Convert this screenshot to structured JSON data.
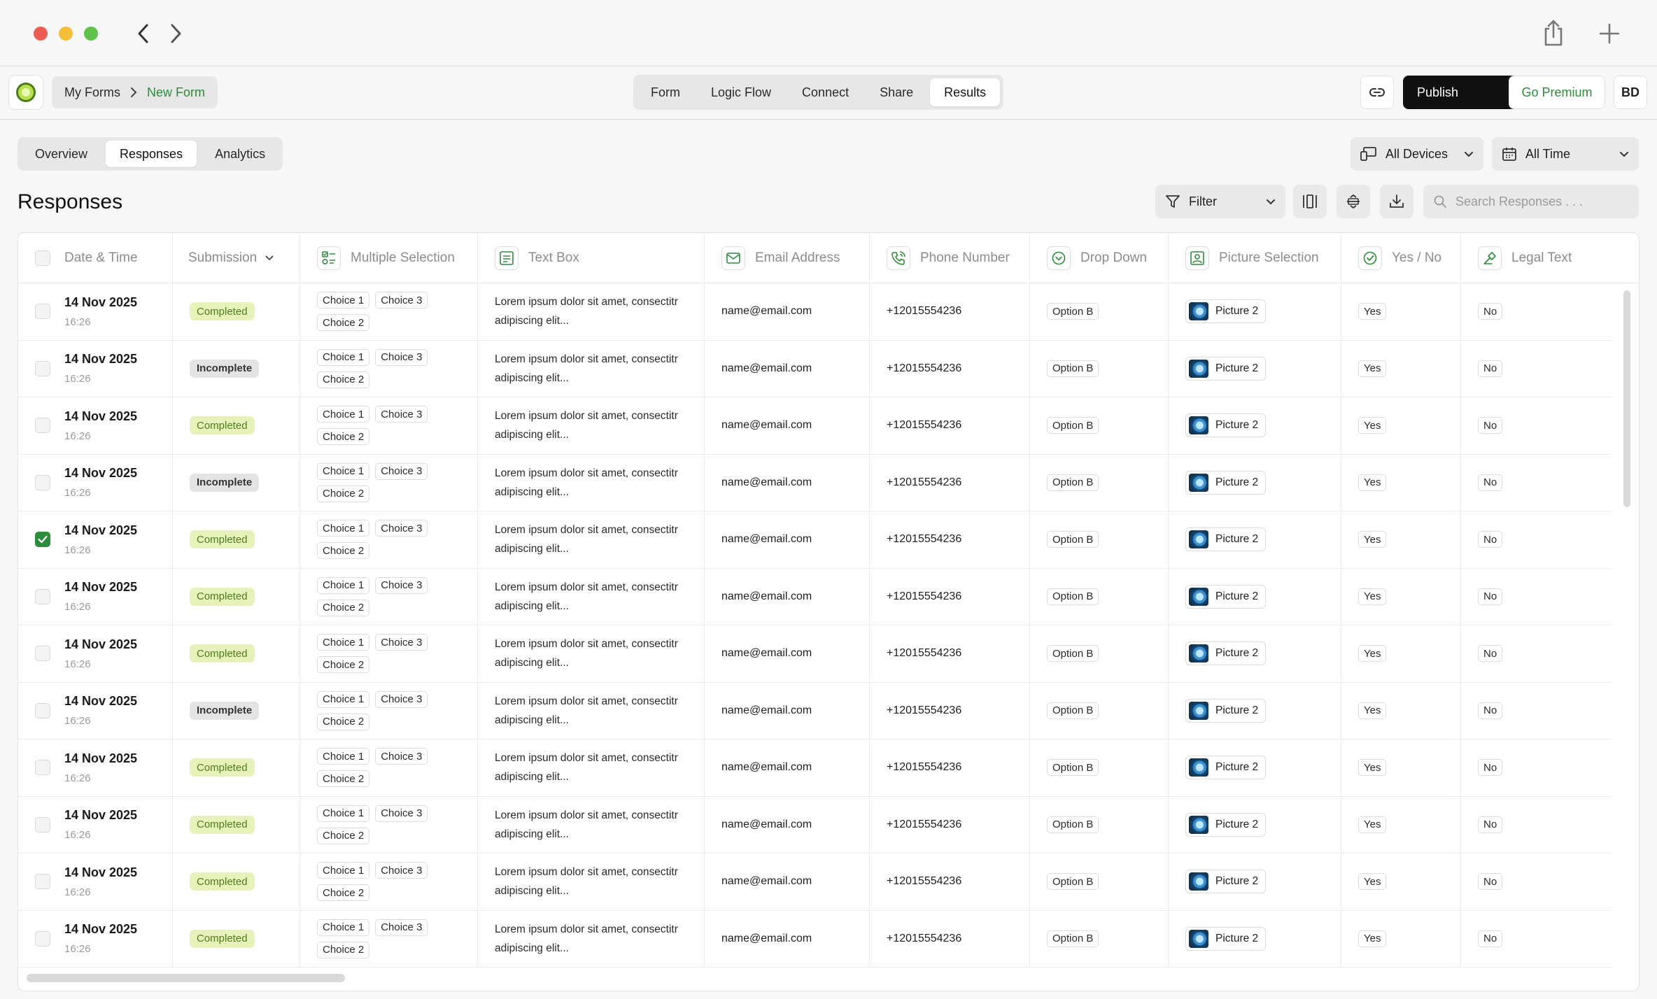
{
  "header": {
    "breadcrumb_home": "My Forms",
    "breadcrumb_current": "New Form",
    "nav_tabs": [
      "Form",
      "Logic Flow",
      "Connect",
      "Share",
      "Results"
    ],
    "active_nav_tab": "Results",
    "publish_label": "Publish",
    "premium_label": "Go Premium",
    "user_initials": "BD"
  },
  "subtabs": [
    "Overview",
    "Responses",
    "Analytics"
  ],
  "active_subtab": "Responses",
  "filters": {
    "devices_label": "All Devices",
    "time_label": "All Time",
    "filter_label": "Filter",
    "search_placeholder": "Search Responses . . ."
  },
  "page_title": "Responses",
  "columns": [
    "Date & Time",
    "Submission",
    "Multiple Selection",
    "Text Box",
    "Email Address",
    "Phone Number",
    "Drop Down",
    "Picture Selection",
    "Yes / No",
    "Legal Text"
  ],
  "column_icons": [
    "",
    "chevron-down-icon",
    "multiple-selection-icon",
    "text-box-icon",
    "email-icon",
    "phone-icon",
    "dropdown-icon",
    "picture-icon",
    "yes-no-icon",
    "legal-icon"
  ],
  "rows": [
    {
      "checked": false,
      "date": "14 Nov 2025",
      "time": "16:26",
      "status": "Completed",
      "choices": [
        "Choice 1",
        "Choice 3",
        "Choice 2"
      ],
      "text": "Lorem ipsum dolor sit amet, consectitr adipiscing elit...",
      "email": "name@email.com",
      "phone": "+12015554236",
      "dropdown": "Option B",
      "picture": "Picture 2",
      "yesno": "Yes",
      "legal": "No"
    },
    {
      "checked": false,
      "date": "14 Nov 2025",
      "time": "16:26",
      "status": "Incomplete",
      "choices": [
        "Choice 1",
        "Choice 3",
        "Choice 2"
      ],
      "text": "Lorem ipsum dolor sit amet, consectitr adipiscing elit...",
      "email": "name@email.com",
      "phone": "+12015554236",
      "dropdown": "Option B",
      "picture": "Picture 2",
      "yesno": "Yes",
      "legal": "No"
    },
    {
      "checked": false,
      "date": "14 Nov 2025",
      "time": "16:26",
      "status": "Completed",
      "choices": [
        "Choice 1",
        "Choice 3",
        "Choice 2"
      ],
      "text": "Lorem ipsum dolor sit amet, consectitr adipiscing elit...",
      "email": "name@email.com",
      "phone": "+12015554236",
      "dropdown": "Option B",
      "picture": "Picture 2",
      "yesno": "Yes",
      "legal": "No"
    },
    {
      "checked": false,
      "date": "14 Nov 2025",
      "time": "16:26",
      "status": "Incomplete",
      "choices": [
        "Choice 1",
        "Choice 3",
        "Choice 2"
      ],
      "text": "Lorem ipsum dolor sit amet, consectitr adipiscing elit...",
      "email": "name@email.com",
      "phone": "+12015554236",
      "dropdown": "Option B",
      "picture": "Picture 2",
      "yesno": "Yes",
      "legal": "No"
    },
    {
      "checked": true,
      "date": "14 Nov 2025",
      "time": "16:26",
      "status": "Completed",
      "choices": [
        "Choice 1",
        "Choice 3",
        "Choice 2"
      ],
      "text": "Lorem ipsum dolor sit amet, consectitr adipiscing elit...",
      "email": "name@email.com",
      "phone": "+12015554236",
      "dropdown": "Option B",
      "picture": "Picture 2",
      "yesno": "Yes",
      "legal": "No"
    },
    {
      "checked": false,
      "date": "14 Nov 2025",
      "time": "16:26",
      "status": "Completed",
      "choices": [
        "Choice 1",
        "Choice 3",
        "Choice 2"
      ],
      "text": "Lorem ipsum dolor sit amet, consectitr adipiscing elit...",
      "email": "name@email.com",
      "phone": "+12015554236",
      "dropdown": "Option B",
      "picture": "Picture 2",
      "yesno": "Yes",
      "legal": "No"
    },
    {
      "checked": false,
      "date": "14 Nov 2025",
      "time": "16:26",
      "status": "Completed",
      "choices": [
        "Choice 1",
        "Choice 3",
        "Choice 2"
      ],
      "text": "Lorem ipsum dolor sit amet, consectitr adipiscing elit...",
      "email": "name@email.com",
      "phone": "+12015554236",
      "dropdown": "Option B",
      "picture": "Picture 2",
      "yesno": "Yes",
      "legal": "No"
    },
    {
      "checked": false,
      "date": "14 Nov 2025",
      "time": "16:26",
      "status": "Incomplete",
      "choices": [
        "Choice 1",
        "Choice 3",
        "Choice 2"
      ],
      "text": "Lorem ipsum dolor sit amet, consectitr adipiscing elit...",
      "email": "name@email.com",
      "phone": "+12015554236",
      "dropdown": "Option B",
      "picture": "Picture 2",
      "yesno": "Yes",
      "legal": "No"
    },
    {
      "checked": false,
      "date": "14 Nov 2025",
      "time": "16:26",
      "status": "Completed",
      "choices": [
        "Choice 1",
        "Choice 3",
        "Choice 2"
      ],
      "text": "Lorem ipsum dolor sit amet, consectitr adipiscing elit...",
      "email": "name@email.com",
      "phone": "+12015554236",
      "dropdown": "Option B",
      "picture": "Picture 2",
      "yesno": "Yes",
      "legal": "No"
    },
    {
      "checked": false,
      "date": "14 Nov 2025",
      "time": "16:26",
      "status": "Completed",
      "choices": [
        "Choice 1",
        "Choice 3",
        "Choice 2"
      ],
      "text": "Lorem ipsum dolor sit amet, consectitr adipiscing elit...",
      "email": "name@email.com",
      "phone": "+12015554236",
      "dropdown": "Option B",
      "picture": "Picture 2",
      "yesno": "Yes",
      "legal": "No"
    },
    {
      "checked": false,
      "date": "14 Nov 2025",
      "time": "16:26",
      "status": "Completed",
      "choices": [
        "Choice 1",
        "Choice 3",
        "Choice 2"
      ],
      "text": "Lorem ipsum dolor sit amet, consectitr adipiscing elit...",
      "email": "name@email.com",
      "phone": "+12015554236",
      "dropdown": "Option B",
      "picture": "Picture 2",
      "yesno": "Yes",
      "legal": "No"
    },
    {
      "checked": false,
      "date": "14 Nov 2025",
      "time": "16:26",
      "status": "Completed",
      "choices": [
        "Choice 1",
        "Choice 3",
        "Choice 2"
      ],
      "text": "Lorem ipsum dolor sit amet, consectitr adipiscing elit...",
      "email": "name@email.com",
      "phone": "+12015554236",
      "dropdown": "Option B",
      "picture": "Picture 2",
      "yesno": "Yes",
      "legal": "No"
    }
  ],
  "colors": {
    "accent_green": "#2f8a3c",
    "completed_bg": "#e6f2b9",
    "completed_text": "#4f7d1d",
    "incomplete_bg": "#e3e3e3",
    "publish_bg": "#111111",
    "traffic_red": "#ee5b52",
    "traffic_yellow": "#f5bd3a",
    "traffic_green": "#5fc148"
  }
}
